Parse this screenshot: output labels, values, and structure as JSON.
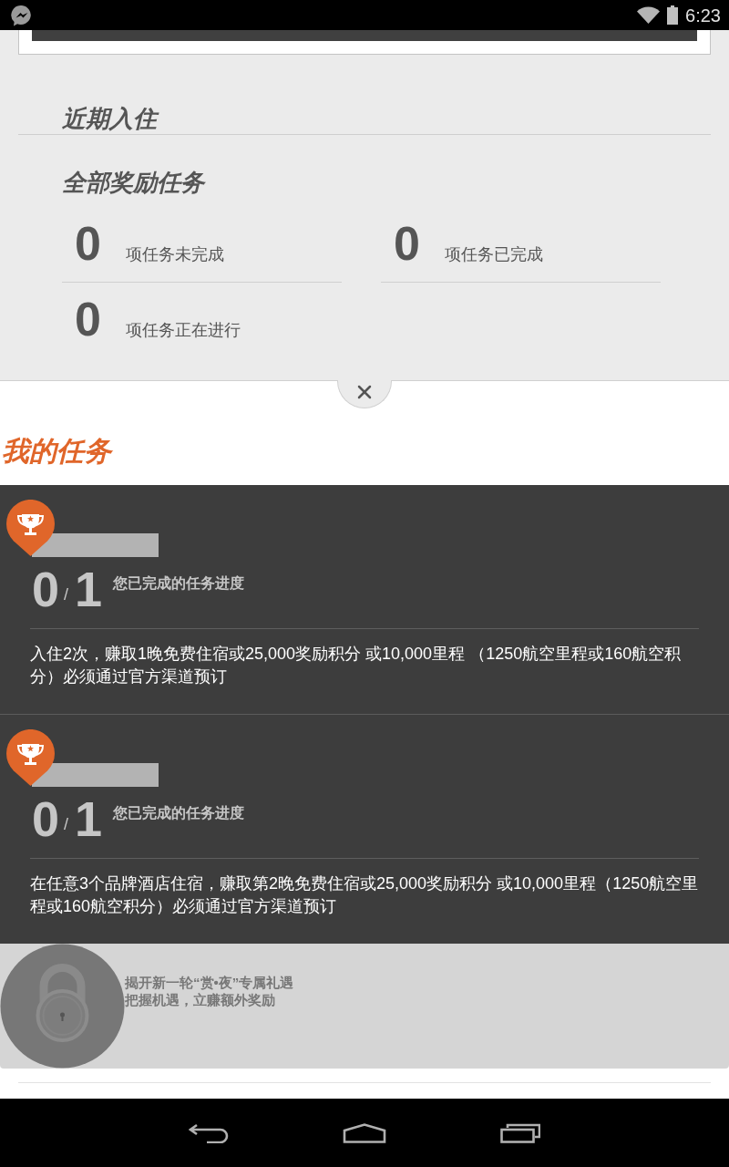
{
  "status_bar": {
    "time": "6:23"
  },
  "recent_stays": {
    "title": "近期入住"
  },
  "all_reward_tasks": {
    "title": "全部奖励任务",
    "stats": [
      {
        "count": "0",
        "label": "项任务未完成"
      },
      {
        "count": "0",
        "label": "项任务已完成"
      },
      {
        "count": "0",
        "label": "项任务正在进行"
      }
    ]
  },
  "my_tasks": {
    "title": "我的任务",
    "tasks": [
      {
        "completed": "0",
        "separator": "/",
        "total": "1",
        "progress_label": "您已完成的任务进度",
        "description": "入住2次，赚取1晚免费住宿或25,000奖励积分 或10,000里程 （1250航空里程或160航空积分）必须通过官方渠道预订"
      },
      {
        "completed": "0",
        "separator": "/",
        "total": "1",
        "progress_label": "您已完成的任务进度",
        "description": "在任意3个品牌酒店住宿，赚取第2晚免费住宿或25,000奖励积分 或10,000里程（1250航空里程或160航空积分）必须通过官方渠道预订"
      }
    ]
  },
  "locked_offer": {
    "title": "揭开新一轮“赏•夜”专属礼遇",
    "subtitle": "把握机遇，立赚额外奖励"
  }
}
